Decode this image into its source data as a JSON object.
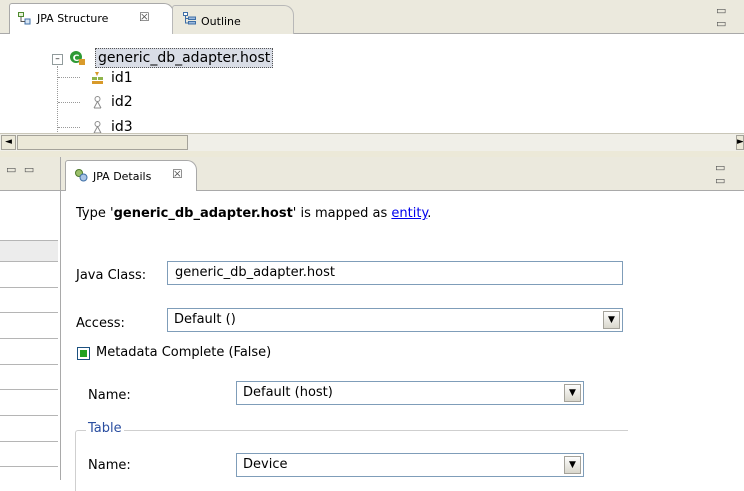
{
  "top_view": {
    "tabs": [
      {
        "label": "JPA Structure",
        "close": "☒"
      },
      {
        "label": "Outline"
      }
    ],
    "controls": "▭ ▭",
    "tree": {
      "root": "generic_db_adapter.host",
      "children": [
        "id1",
        "id2",
        "id3"
      ]
    },
    "scroll_left": "◄",
    "scroll_right": "►"
  },
  "left_view": {
    "controls": "▭ ▭"
  },
  "details": {
    "tab_label": "JPA Details",
    "tab_close": "☒",
    "controls": "▭ ▭",
    "mapping": {
      "prefix": "Type '",
      "type_name": "generic_db_adapter.host",
      "middle": "' is mapped as ",
      "link": "entity",
      "suffix": "."
    },
    "java_class": {
      "label": "Java Class:",
      "value": "generic_db_adapter.host"
    },
    "access": {
      "label": "Access:",
      "value": "Default ()"
    },
    "metadata_complete": {
      "label": "Metadata Complete (False)"
    },
    "name": {
      "label": "Name:",
      "value": "Default (host)"
    },
    "table": {
      "group_label": "Table",
      "name_label": "Name:",
      "name_value": "Device"
    }
  },
  "colors": {
    "view_header": "#ebe9dd",
    "border": "#a9a9a9",
    "entity_icon": "#2e9a35",
    "link": "#0000ee",
    "group_label": "#2a4ea0"
  }
}
